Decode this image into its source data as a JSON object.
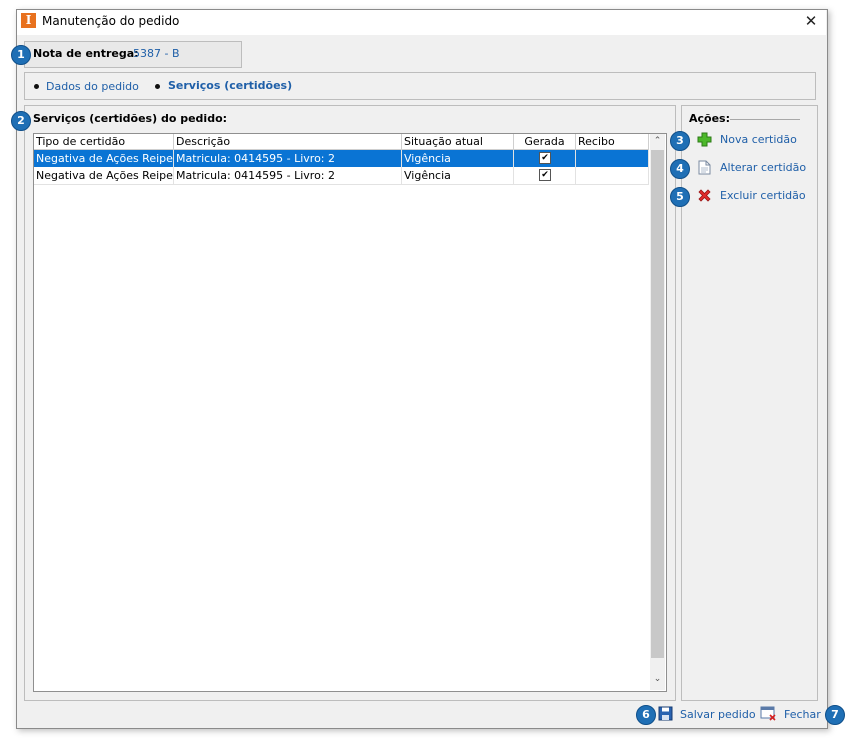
{
  "window": {
    "title": "Manutenção do pedido",
    "icon_letter": "I",
    "close_glyph": "✕"
  },
  "note": {
    "label": "Nota de entrega:",
    "value": "5387 - B"
  },
  "tabs": [
    {
      "label": "Dados do pedido",
      "active": false
    },
    {
      "label": "Serviços (certidões)",
      "active": true
    }
  ],
  "services": {
    "title": "Serviços (certidões) do pedido:",
    "columns": [
      "Tipo de certidão",
      "Descrição",
      "Situação atual",
      "Gerada",
      "Recibo"
    ],
    "rows": [
      {
        "tipo": "Negativa de Ações Reipersecutórias",
        "descricao": "Matricula: 0414595 - Livro: 2",
        "situacao": "Vigência",
        "gerada": "✔",
        "recibo": "",
        "selected": true
      },
      {
        "tipo": "Negativa de Ações Reipersecutórias",
        "descricao": "Matricula: 0414595 - Livro: 2",
        "situacao": "Vigência",
        "gerada": "✔",
        "recibo": "",
        "selected": false
      }
    ]
  },
  "actions": {
    "title": "Ações:",
    "items": [
      {
        "label": "Nova certidão",
        "icon": "plus-icon"
      },
      {
        "label": "Alterar certidão",
        "icon": "document-icon"
      },
      {
        "label": "Excluir certidão",
        "icon": "delete-x-icon"
      }
    ]
  },
  "footer": {
    "save_label": "Salvar pedido",
    "close_label": "Fechar"
  },
  "badges": [
    "1",
    "2",
    "3",
    "4",
    "5",
    "6",
    "7"
  ],
  "scroll": {
    "up": "⌃",
    "down": "⌄"
  },
  "colors": {
    "accent": "#1f6fb5",
    "selection": "#0a74d4",
    "link": "#1f5fa8",
    "app_icon": "#e8711e"
  }
}
